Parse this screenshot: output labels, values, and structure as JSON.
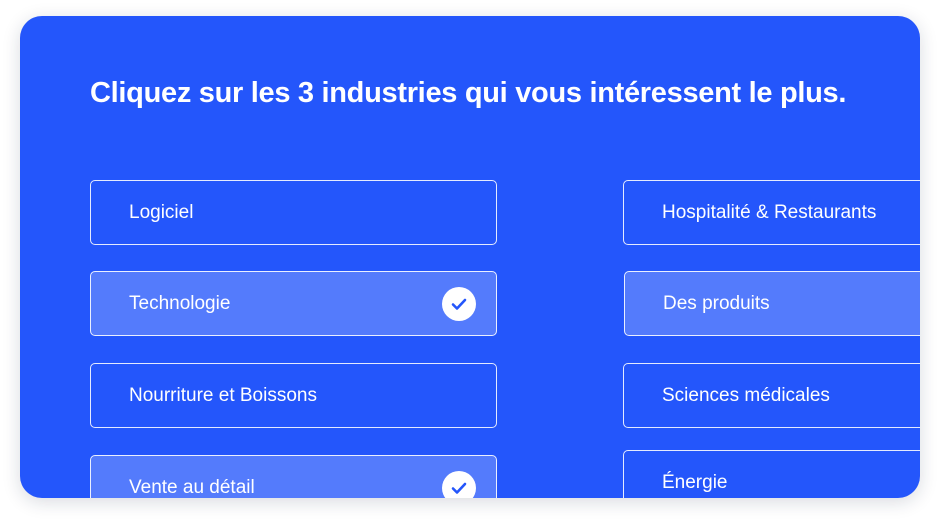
{
  "heading": "Cliquez sur les 3 industries qui vous intéressent le plus.",
  "accent_color": "#2456fb",
  "options": [
    {
      "label": "Logiciel",
      "selected": false
    },
    {
      "label": "Technologie",
      "selected": true
    },
    {
      "label": "Nourriture et Boissons",
      "selected": false
    },
    {
      "label": "Vente au détail",
      "selected": true
    },
    {
      "label": "Hospitalité & Restaurants",
      "selected": false
    },
    {
      "label": "Des produits",
      "selected": true
    },
    {
      "label": "Sciences médicales",
      "selected": false
    },
    {
      "label": "Énergie",
      "selected": false
    }
  ],
  "icons": {
    "selected": "check-icon"
  }
}
